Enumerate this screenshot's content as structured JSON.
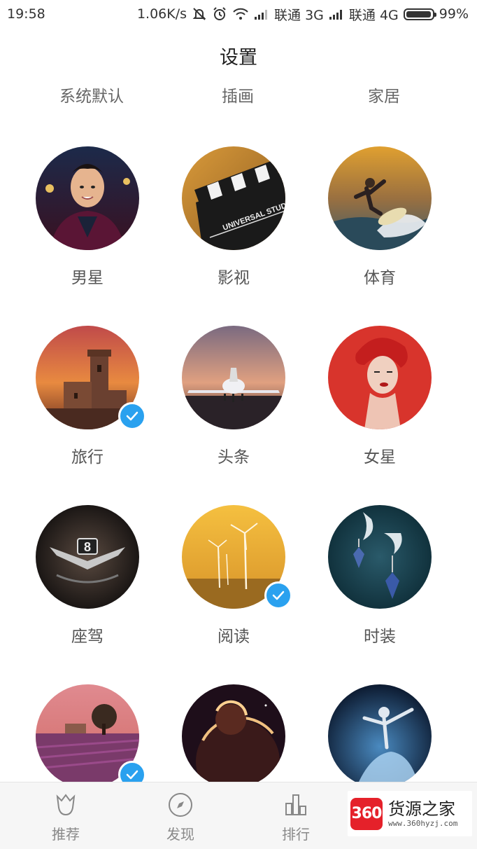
{
  "status_bar": {
    "time": "19:58",
    "net_speed": "1.06K/s",
    "carrier1": "联通 3G",
    "carrier2": "联通 4G",
    "battery": "99%",
    "battery_level": 0.99
  },
  "page": {
    "title": "设置"
  },
  "theme_tabs": [
    "系统默认",
    "插画",
    "家居"
  ],
  "categories": [
    {
      "label": "男星",
      "selected": false,
      "image": "male-star-portrait"
    },
    {
      "label": "影视",
      "selected": false,
      "image": "film-clapperboard"
    },
    {
      "label": "体育",
      "selected": false,
      "image": "surfer"
    },
    {
      "label": "旅行",
      "selected": true,
      "image": "castle-tower-sunset"
    },
    {
      "label": "头条",
      "selected": false,
      "image": "private-jet"
    },
    {
      "label": "女星",
      "selected": false,
      "image": "female-star-red"
    },
    {
      "label": "座驾",
      "selected": false,
      "image": "car-emblem"
    },
    {
      "label": "阅读",
      "selected": true,
      "image": "wind-turbines"
    },
    {
      "label": "时装",
      "selected": false,
      "image": "jewelry"
    },
    {
      "label": "",
      "selected": true,
      "image": "lavender-field-tree"
    },
    {
      "label": "",
      "selected": false,
      "image": "planet-explosion"
    },
    {
      "label": "",
      "selected": false,
      "image": "dancer-blue"
    }
  ],
  "bottom_nav": [
    {
      "label": "推荐",
      "icon": "tulip-icon"
    },
    {
      "label": "发现",
      "icon": "compass-icon"
    },
    {
      "label": "排行",
      "icon": "bar-chart-icon"
    }
  ],
  "watermark": {
    "logo_text": "360",
    "name": "货源之家",
    "url": "www.360hyzj.com"
  },
  "colors": {
    "accent": "#2aa1ef",
    "nav_bg": "#f6f6f6",
    "text": "#333333",
    "watermark_red": "#e5212a"
  }
}
